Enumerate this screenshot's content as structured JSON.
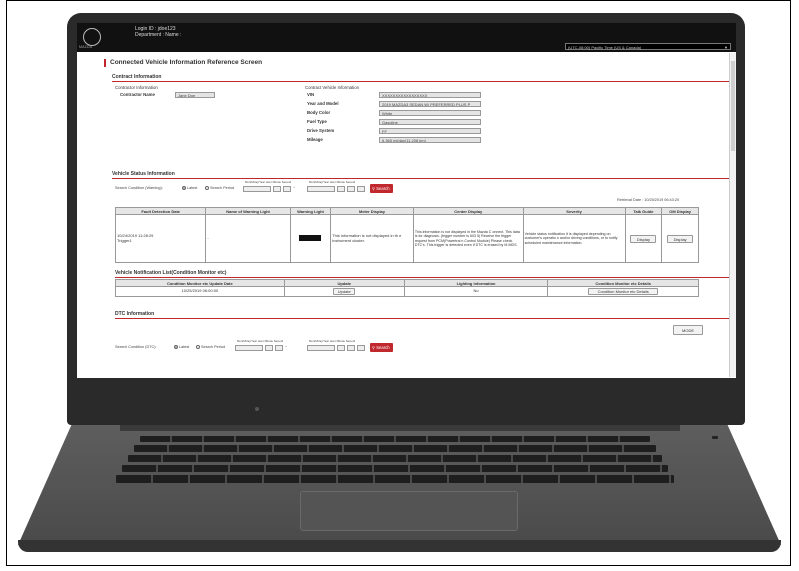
{
  "header": {
    "login_id": "Login ID : jdoe123",
    "department": "Department :       Name :",
    "logo_text": "MAZDA",
    "timezone": "(UTC-08:00) Pacific Time (US & Canada)"
  },
  "page_title": "Connected Vehicle Information Reference Screen",
  "contract": {
    "section_title": "Contract Information",
    "contractor_info_label": "Contractor Information",
    "contractor_name_label": "Contractor Name",
    "contractor_name_value": "Jane Doe",
    "vehicle_info_label": "Contract Vehicle Information",
    "fields": [
      {
        "label": "VIN",
        "value": "XXXXXXXXXXXXXXXXX"
      },
      {
        "label": "Year and Model",
        "value": "2019 MAZDA3 SEDAN W/ PREFERRED PLUS P"
      },
      {
        "label": "Body Color",
        "value": "White"
      },
      {
        "label": "Fuel Type",
        "value": "Gasoline"
      },
      {
        "label": "Drive System",
        "value": "FF"
      },
      {
        "label": "Mileage",
        "value": "6,365 mi/day(11,208 km)"
      }
    ]
  },
  "vehicle_status": {
    "section_title": "Vehicle Status Information",
    "search_label": "Search Condition (Warning):",
    "latest_label": "Latest",
    "period_label": "Search Period",
    "date_caption": "Month/Day/Year   Hour   Minute   Second",
    "search_button": "Search",
    "retrieval_date": "Retrieval Date : 10/25/2019 06:43:20",
    "headers": [
      "Fault Detection Date",
      "Name of Warning Light",
      "Warning Light",
      "Meter Display",
      "Center Display",
      "Severity",
      "Talk Guide",
      "OM Display"
    ],
    "row": {
      "date": "10/24/2019 11:28:29",
      "trigger": "Trigger1",
      "name": "-",
      "meter": "This information is not displayed in th e Instrument cluster.",
      "center": "This information is not displayed in the Mazda C onnect. This data is for diagnosis. (trigger number is 603 5) Receive the trigger request from PCM(Powertrai n Control Module) Please check DTC's. This trigger is detected even if DTC is erased by M-MDS.",
      "severity": "Vehicle status notification It is displayed depending on customer's operatio n and/or driving conditions, or to notify scheduled maintenance information.",
      "talk_button": "Display",
      "om_button": "Display"
    }
  },
  "notification": {
    "section_title": "Vehicle Notification List(Condition Monitor etc)",
    "headers": [
      "Condition Monitor etc Update Date",
      "Update",
      "Lighting Information",
      "Condition Monitor etc Details"
    ],
    "row": {
      "date": "10/25/2019 06:00:00",
      "update_button": "Update",
      "lighting": "No",
      "details_button": "Condition Monitor etc Details"
    }
  },
  "dtc": {
    "section_title": "DTC Information",
    "mode_button": "MODE",
    "search_label": "Search Condition (DTC):",
    "latest_label": "Latest",
    "period_label": "Search Period",
    "date_caption": "Month/Day/Year   Hour   Minute   Second",
    "search_button": "Search"
  },
  "colors": {
    "accent": "#c0282d",
    "topbar": "#111111",
    "laptop": "#2a2a2a"
  }
}
